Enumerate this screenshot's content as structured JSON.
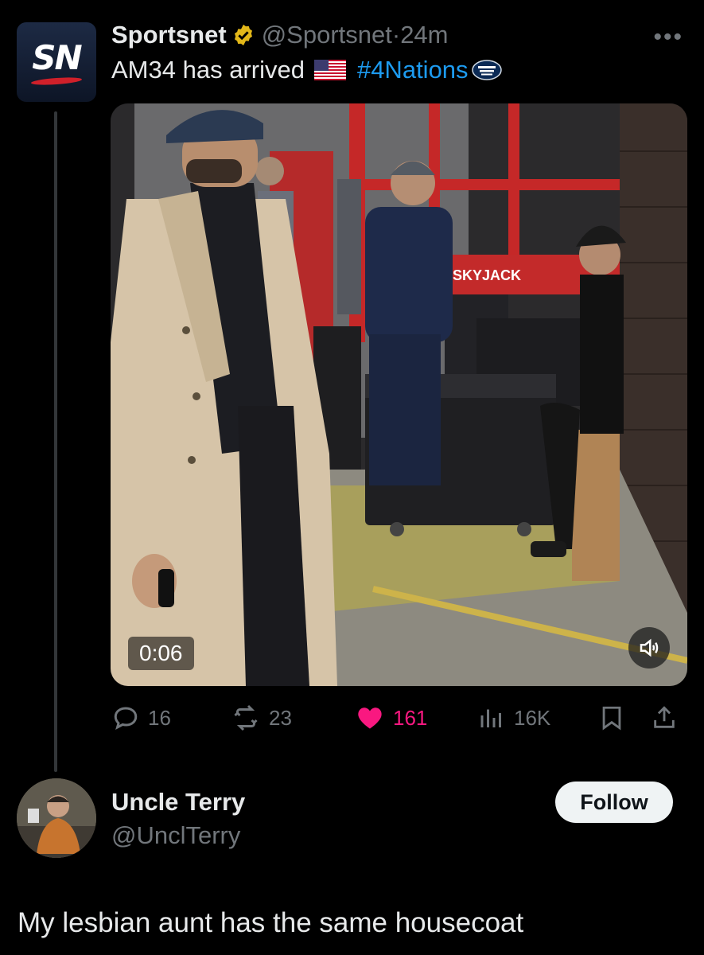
{
  "tweet": {
    "author_name": "Sportsnet",
    "handle": "@Sportsnet",
    "separator": "·",
    "time": "24m",
    "avatar_text": "SN",
    "verified": true,
    "text_prefix": "AM34 has arrived",
    "hashtag": "#4Nations",
    "more_icon": "more-horizontal-icon"
  },
  "video": {
    "duration": "0:06",
    "sign_text": "SKYJACK"
  },
  "actions": {
    "replies": "16",
    "reposts": "23",
    "likes": "161",
    "views": "16K"
  },
  "reply": {
    "name": "Uncle Terry",
    "handle": "@UnclTerry",
    "follow_label": "Follow",
    "text": "My lesbian aunt has the same housecoat"
  },
  "colors": {
    "background": "#000000",
    "text": "#e7e9ea",
    "muted": "#71767b",
    "link": "#1d9bf0",
    "like": "#f91880",
    "verified": "#e2b719"
  }
}
